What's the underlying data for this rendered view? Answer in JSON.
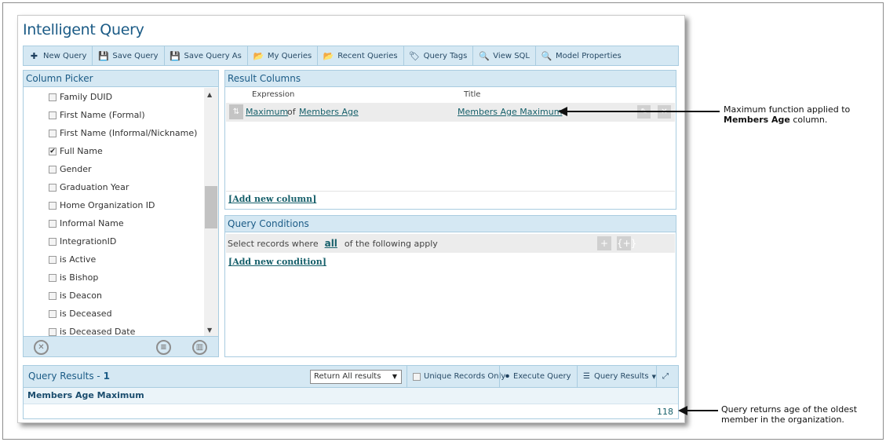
{
  "app": {
    "title": "Intelligent Query"
  },
  "toolbar": [
    {
      "label": "New Query",
      "icon": "plus-icon",
      "glyph": "✚"
    },
    {
      "label": "Save Query",
      "icon": "floppy-icon",
      "glyph": "💾"
    },
    {
      "label": "Save Query As",
      "icon": "floppy-icon",
      "glyph": "💾"
    },
    {
      "label": "My Queries",
      "icon": "folder-open-icon",
      "glyph": "📂"
    },
    {
      "label": "Recent Queries",
      "icon": "folder-open-icon",
      "glyph": "📂"
    },
    {
      "label": "Query Tags",
      "icon": "tag-icon",
      "glyph": "🏷"
    },
    {
      "label": "View SQL",
      "icon": "search-icon",
      "glyph": "🔍"
    },
    {
      "label": "Model Properties",
      "icon": "search-icon",
      "glyph": "🔍"
    }
  ],
  "picker": {
    "title": "Column Picker",
    "items": [
      {
        "label": "Family DUID",
        "checked": false
      },
      {
        "label": "First Name (Formal)",
        "checked": false
      },
      {
        "label": "First Name (Informal/Nickname)",
        "checked": false
      },
      {
        "label": "Full Name",
        "checked": true
      },
      {
        "label": "Gender",
        "checked": false
      },
      {
        "label": "Graduation Year",
        "checked": false
      },
      {
        "label": "Home Organization ID",
        "checked": false
      },
      {
        "label": "Informal Name",
        "checked": false
      },
      {
        "label": "IntegrationID",
        "checked": false
      },
      {
        "label": "is Active",
        "checked": false
      },
      {
        "label": "is Bishop",
        "checked": false
      },
      {
        "label": "is Deacon",
        "checked": false
      },
      {
        "label": "is Deceased",
        "checked": false
      },
      {
        "label": "is Deceased Date",
        "checked": false
      }
    ]
  },
  "result_columns": {
    "title": "Result Columns",
    "header_expression": "Expression",
    "header_title": "Title",
    "row": {
      "func": "Maximum",
      "of": "of",
      "field": "Members Age",
      "title": "Members Age Maximum"
    },
    "add_label": "[Add new column]"
  },
  "conditions": {
    "title": "Query Conditions",
    "prefix": "Select records where",
    "mode": "all",
    "suffix": "of the following apply",
    "add_label": "[Add new condition]"
  },
  "query_results": {
    "title": "Query Results - ",
    "count": "1",
    "return_option": "Return All results",
    "unique_label": "Unique Records Only",
    "execute_label": "Execute Query",
    "results_label": "Query Results",
    "column": "Members Age Maximum",
    "value": "118"
  },
  "annotations": {
    "a1_line1": "Maximum function applied to",
    "a1_bold": "Members Age",
    "a1_rest": " column.",
    "a2_line1": "Query returns age of the oldest",
    "a2_line2": "member in the organization."
  }
}
